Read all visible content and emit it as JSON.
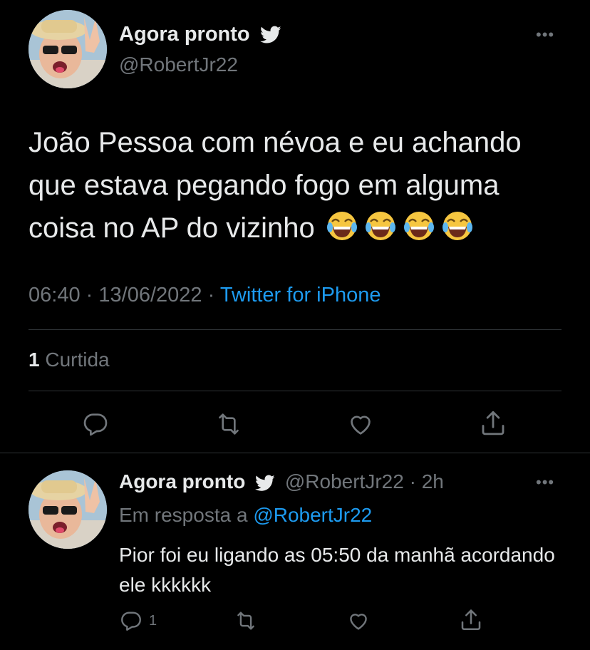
{
  "main_tweet": {
    "display_name": "Agora pronto",
    "handle": "@RobertJr22",
    "text": "João Pessoa com névoa e eu achando que estava pegando fogo em alguma coisa no AP do vizinho",
    "emojis": [
      "face-with-tears-of-joy",
      "face-with-tears-of-joy",
      "face-with-tears-of-joy",
      "face-with-tears-of-joy"
    ],
    "time": "06:40",
    "date": "13/06/2022",
    "separator": "·",
    "source": "Twitter for iPhone",
    "like_count": "1",
    "like_label": "Curtida"
  },
  "reply_tweet": {
    "display_name": "Agora pronto",
    "handle": "@RobertJr22",
    "separator": "·",
    "time_ago": "2h",
    "reply_prefix": "Em resposta a",
    "reply_to_handle": "@RobertJr22",
    "text": "Pior foi eu ligando as 05:50 da manhã acordando ele kkkkkk",
    "reply_count": "1"
  },
  "icons": {
    "verified_bird": "twitter-bird-icon",
    "more": "more-icon",
    "reply": "reply-icon",
    "retweet": "retweet-icon",
    "like": "like-icon",
    "share": "share-icon"
  },
  "colors": {
    "background": "#000000",
    "text": "#e7e9ea",
    "secondary": "#71767b",
    "accent": "#1d9bf0",
    "divider": "#2f3336"
  }
}
